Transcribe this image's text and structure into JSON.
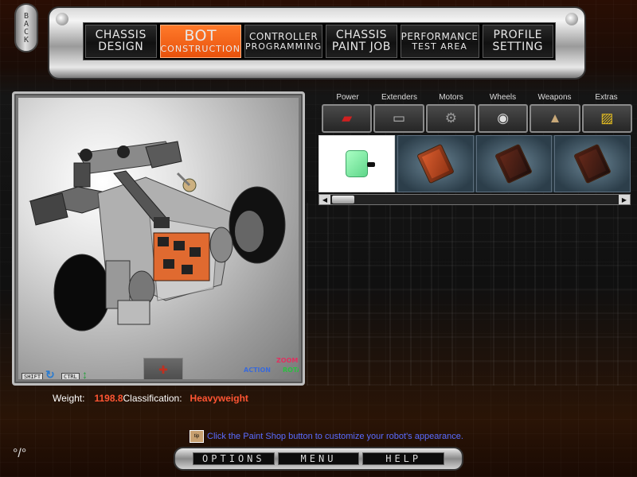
{
  "back": {
    "label": "BACK"
  },
  "nav": {
    "tabs": [
      {
        "line1": "CHASSIS",
        "line2": "DESIGN"
      },
      {
        "line1": "BOT",
        "line2": "CONSTRUCTION"
      },
      {
        "line1": "CONTROLLER",
        "line2": "PROGRAMMING"
      },
      {
        "line1": "CHASSIS",
        "line2": "PAINT JOB"
      },
      {
        "line1": "PERFORMANCE",
        "line2": "TEST AREA"
      },
      {
        "line1": "PROFILE",
        "line2": "SETTING"
      }
    ],
    "active_index": 1
  },
  "viewport": {
    "keys": {
      "shift": "SHIFT",
      "ctrl": "CTRL"
    },
    "modes": {
      "action": "ACTION",
      "zoom": "ZOOM",
      "rotate": "ROTATE"
    }
  },
  "categories": {
    "labels": [
      "Power",
      "Extenders",
      "Motors",
      "Wheels",
      "Weapons",
      "Extras"
    ],
    "icons": [
      "power-icon",
      "extender-icon",
      "motor-icon",
      "wheel-icon",
      "weapon-icon",
      "extras-icon"
    ]
  },
  "parts": {
    "selected_index": 0
  },
  "stats": {
    "weight_label": "Weight:",
    "weight_value": "1198.8",
    "classification_label": "Classification:",
    "classification_value": "Heavyweight"
  },
  "hint": {
    "icon_text": "tip",
    "text": "Click the Paint Shop button to customize your robot's appearance."
  },
  "bottom": {
    "options": "OPTIONS",
    "menu": "MENU",
    "help": "HELP"
  },
  "colors": {
    "accent": "#e8510c",
    "value_red": "#ff5533",
    "hint_blue": "#5a6cff"
  }
}
